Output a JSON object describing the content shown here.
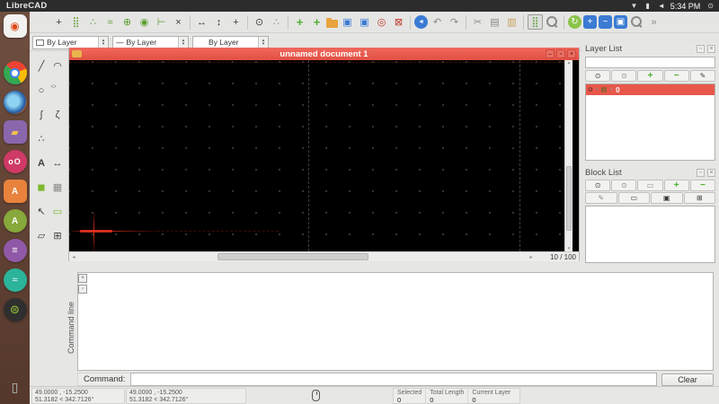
{
  "colors": {
    "accent_red": "#e8574a",
    "snap_green": "#5a9e2f",
    "canvas_bg": "#000000"
  },
  "system_bar": {
    "app_title": "LibreCAD",
    "clock": "5:34 PM",
    "tray": [
      {
        "name": "network-icon",
        "g": "▼"
      },
      {
        "name": "battery-icon",
        "g": "▮"
      },
      {
        "name": "volume-icon",
        "g": "◄"
      }
    ],
    "session_icon": "⊙"
  },
  "launcher": {
    "items": [
      {
        "name": "launcher-ubuntu",
        "g": "◉",
        "cls": "ubuntu"
      },
      {
        "name": "launcher-chrome",
        "g": "",
        "cls": "chrome pipL"
      },
      {
        "name": "launcher-firefox",
        "g": "",
        "cls": "firefox"
      },
      {
        "name": "launcher-files",
        "g": "▰",
        "cls": "files"
      },
      {
        "name": "launcher-photos-app",
        "g": "oO",
        "cls": "pinkapp"
      },
      {
        "name": "launcher-software-app",
        "g": "A",
        "cls": "softwareapp"
      },
      {
        "name": "launcher-software-center",
        "g": "A",
        "cls": "greenapp"
      },
      {
        "name": "launcher-writer-app",
        "g": "≡",
        "cls": "writerapp"
      },
      {
        "name": "launcher-system-monitor",
        "g": "≈",
        "cls": "monitorapp"
      },
      {
        "name": "launcher-librecad",
        "g": "⊜",
        "cls": "librecadapp pipL pipR"
      },
      {
        "name": "launcher-trash",
        "g": "▯",
        "cls": "trashapp"
      }
    ]
  },
  "main_toolbar": {
    "icons": [
      {
        "name": "snap-free-icon",
        "g": "+",
        "cls": "dk"
      },
      {
        "name": "snap-grid-icon",
        "g": "⣿",
        "cls": "gn"
      },
      {
        "name": "snap-endpoint-icon",
        "g": "∴",
        "cls": "gn"
      },
      {
        "name": "snap-entity-icon",
        "g": "≈",
        "cls": "gn"
      },
      {
        "name": "snap-center-icon",
        "g": "⊕",
        "cls": "gn"
      },
      {
        "name": "snap-middle-icon",
        "g": "◉",
        "cls": "gn"
      },
      {
        "name": "snap-distance-icon",
        "g": "⊢",
        "cls": "gn"
      },
      {
        "name": "snap-intersection-icon",
        "g": "×",
        "cls": "dk"
      },
      {
        "cls": "sep"
      },
      {
        "name": "restrict-horizontal-icon",
        "g": "↔",
        "cls": "dk"
      },
      {
        "name": "restrict-vertical-icon",
        "g": "↕",
        "cls": "dk"
      },
      {
        "name": "restrict-orthogonal-icon",
        "g": "+",
        "cls": "dk"
      },
      {
        "cls": "sep"
      },
      {
        "name": "lock-relative-zero-icon",
        "g": "⊙",
        "cls": "dk"
      },
      {
        "name": "relative-zero-icon",
        "g": "∴",
        "cls": "gy"
      },
      {
        "cls": "sep"
      },
      {
        "name": "new-document-icon",
        "g": "+",
        "cls": "gnb"
      },
      {
        "name": "new-from-template-icon",
        "g": "+",
        "cls": "gnb"
      },
      {
        "name": "open-file-icon",
        "g": "",
        "cls": "folder"
      },
      {
        "name": "save-file-icon",
        "g": "▣",
        "cls": "bl"
      },
      {
        "name": "save-as-icon",
        "g": "▣",
        "cls": "bl"
      },
      {
        "name": "revert-icon",
        "g": "◎",
        "cls": "rd"
      },
      {
        "name": "close-document-icon",
        "g": "⊠",
        "cls": "rd"
      },
      {
        "cls": "sep"
      },
      {
        "name": "back-icon",
        "g": "◄",
        "cls": "blc"
      },
      {
        "name": "undo-icon",
        "g": "↶",
        "cls": "gy"
      },
      {
        "name": "redo-icon",
        "g": "↷",
        "cls": "gy"
      },
      {
        "cls": "sep"
      },
      {
        "name": "cut-icon",
        "g": "✂",
        "cls": "gy"
      },
      {
        "name": "copy-icon",
        "g": "▤",
        "cls": "gy"
      },
      {
        "name": "paste-icon",
        "g": "▥",
        "cls": "tan"
      },
      {
        "cls": "sep"
      },
      {
        "name": "grid-toggle-icon",
        "g": "⣿",
        "cls": "gn active"
      },
      {
        "name": "zoom-preview-icon",
        "g": "",
        "cls": "mag"
      },
      {
        "cls": "sep"
      },
      {
        "name": "auto-zoom-icon",
        "g": "↻",
        "cls": "gnc"
      },
      {
        "name": "zoom-in-icon",
        "g": "+",
        "cls": "blsq"
      },
      {
        "name": "zoom-out-icon",
        "g": "−",
        "cls": "blsq"
      },
      {
        "name": "zoom-window-icon",
        "g": "▣",
        "cls": "blsq"
      },
      {
        "name": "zoom-pan-icon",
        "g": "",
        "cls": "mag"
      },
      {
        "name": "toolbar-overflow-icon",
        "g": "»",
        "cls": "gy"
      }
    ]
  },
  "pen_toolbar": {
    "color_value": "By Layer",
    "linetype_prefix": "—",
    "linetype_value": "By Layer",
    "width_value": "By Layer",
    "spinner_up": "▴",
    "spinner_down": "▾"
  },
  "tool_palette": {
    "tools": [
      {
        "name": "line-tool-icon",
        "g": "╱",
        "cls": "dk"
      },
      {
        "name": "arc-tool-icon",
        "g": "◠",
        "cls": "dk"
      },
      {
        "name": "circle-tool-icon",
        "g": "○",
        "cls": "dk"
      },
      {
        "name": "ellipse-tool-icon",
        "g": "○",
        "cls": "dk squish"
      },
      {
        "name": "spline-tool-icon",
        "g": "∫",
        "cls": "dk"
      },
      {
        "name": "polyline-tool-icon",
        "g": "ζ",
        "cls": "dk"
      },
      {
        "name": "point-tool-icon",
        "g": "∴",
        "cls": "dk"
      },
      {
        "cls": "blank"
      },
      {
        "name": "text-tool-icon",
        "g": "A",
        "cls": "dk bold"
      },
      {
        "name": "dimension-tool-icon",
        "g": "↔",
        "cls": "dk"
      },
      {
        "name": "hatch-tool-icon",
        "g": "◼",
        "cls": "gn2"
      },
      {
        "name": "image-tool-icon",
        "g": "▦",
        "cls": "gy"
      },
      {
        "name": "select-tool-icon",
        "g": "↖",
        "cls": "dk"
      },
      {
        "name": "dimension-aligned-icon",
        "g": "▭",
        "cls": "gn2"
      },
      {
        "name": "modify-tool-icon",
        "g": "▱",
        "cls": "dk"
      },
      {
        "name": "explode-tool-icon",
        "g": "⊞",
        "cls": "dk"
      }
    ]
  },
  "document": {
    "title": "unnamed document 1",
    "grid_indicator": "10 / 100",
    "scroll": {
      "up": "▴",
      "down": "▾",
      "left": "◂",
      "right": "▸"
    }
  },
  "mdi_window": {
    "buttons": [
      {
        "name": "minimize-icon",
        "g": "–"
      },
      {
        "name": "restore-icon",
        "g": "▫"
      },
      {
        "name": "close-icon",
        "g": "×"
      }
    ]
  },
  "layer_list": {
    "title": "Layer List",
    "window_buttons": [
      {
        "name": "float-icon",
        "g": "▫"
      },
      {
        "name": "close-icon",
        "g": "×"
      }
    ],
    "toolbar": [
      {
        "name": "show-all-layers-icon",
        "g": "⊙",
        "cls": "dk"
      },
      {
        "name": "hide-all-layers-icon",
        "g": "⊙",
        "cls": "gy"
      },
      {
        "name": "add-layer-icon",
        "g": "+",
        "cls": "gnb2"
      },
      {
        "name": "remove-layer-icon",
        "g": "−",
        "cls": "gnb2"
      },
      {
        "name": "modify-layer-icon",
        "g": "✎",
        "cls": "dk"
      }
    ],
    "row_icons": [
      {
        "name": "layer-visible-icon",
        "g": "⊙",
        "color": "#1a1a1a"
      },
      {
        "name": "layer-lock-icon",
        "g": "▪",
        "color": "#888888"
      },
      {
        "name": "layer-print-icon",
        "g": "▤",
        "color": "#2f6d1f"
      },
      {
        "name": "layer-construction-icon",
        "g": "+",
        "color": "#999999"
      }
    ],
    "layers": [
      {
        "name": "0",
        "selected": true
      }
    ]
  },
  "block_list": {
    "title": "Block List",
    "window_buttons": [
      {
        "name": "float-icon",
        "g": "▫"
      },
      {
        "name": "close-icon",
        "g": "×"
      }
    ],
    "toolbar_row1": [
      {
        "name": "show-all-blocks-icon",
        "g": "⊙",
        "cls": "dk"
      },
      {
        "name": "hide-all-blocks-icon",
        "g": "⊙",
        "cls": "gy"
      },
      {
        "name": "rename-block-icon",
        "g": "▭",
        "cls": "gy"
      },
      {
        "name": "add-block-icon",
        "g": "+",
        "cls": "gnb2"
      },
      {
        "name": "remove-block-icon",
        "g": "−",
        "cls": "gnb2"
      }
    ],
    "toolbar_row2": [
      {
        "name": "create-block-icon",
        "g": "✎",
        "cls": "gy"
      },
      {
        "name": "edit-block-icon",
        "g": "▭",
        "cls": "dk"
      },
      {
        "name": "save-block-icon",
        "g": "▣",
        "cls": "gn2"
      },
      {
        "name": "insert-block-icon",
        "g": "⊞",
        "cls": "gn2"
      }
    ],
    "blocks": []
  },
  "command_line": {
    "dock_title": "Command line",
    "dock_buttons": [
      {
        "name": "close-icon",
        "g": "×"
      },
      {
        "name": "float-icon",
        "g": "▫"
      }
    ],
    "prompt": "Command:",
    "input_value": "",
    "clear_label": "Clear"
  },
  "status_bar": {
    "absolute_coords": {
      "cartesian": "49.0000 , -15.2500",
      "polar": "51.3182 < 342.7126°"
    },
    "relative_coords": {
      "cartesian": "49.0000 , -15.2500",
      "polar": "51.3182 < 342.7126°"
    },
    "selected": {
      "label": "Selected",
      "value": "0"
    },
    "total_length": {
      "label": "Total Length",
      "value": "0"
    },
    "current_layer": {
      "label": "Current Layer",
      "value": "0"
    }
  }
}
